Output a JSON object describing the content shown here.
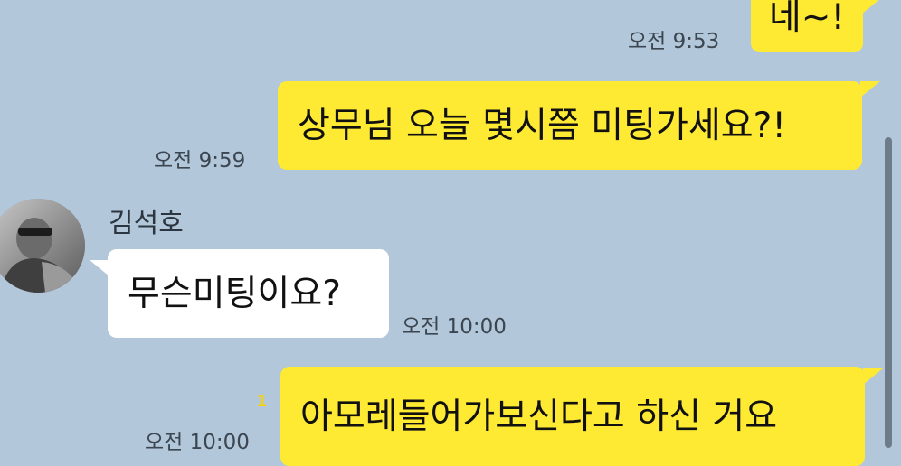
{
  "colors": {
    "background": "#b2c7da",
    "my_bubble": "#fee933",
    "other_bubble": "#ffffff",
    "unread_count": "#f5d20d"
  },
  "messages": [
    {
      "from": "me",
      "text": "네~!",
      "time": "오전 9:53"
    },
    {
      "from": "me",
      "text": "상무님 오늘 몇시쯤 미팅가세요?!",
      "time": "오전 9:59"
    },
    {
      "from": "김석호",
      "text": "무슨미팅이요?",
      "time": "오전 10:00",
      "avatar_icon": "profile-photo"
    },
    {
      "from": "me",
      "text": "아모레들어가보신다고 하신 거요",
      "time": "오전 10:00",
      "unread": "1"
    }
  ]
}
